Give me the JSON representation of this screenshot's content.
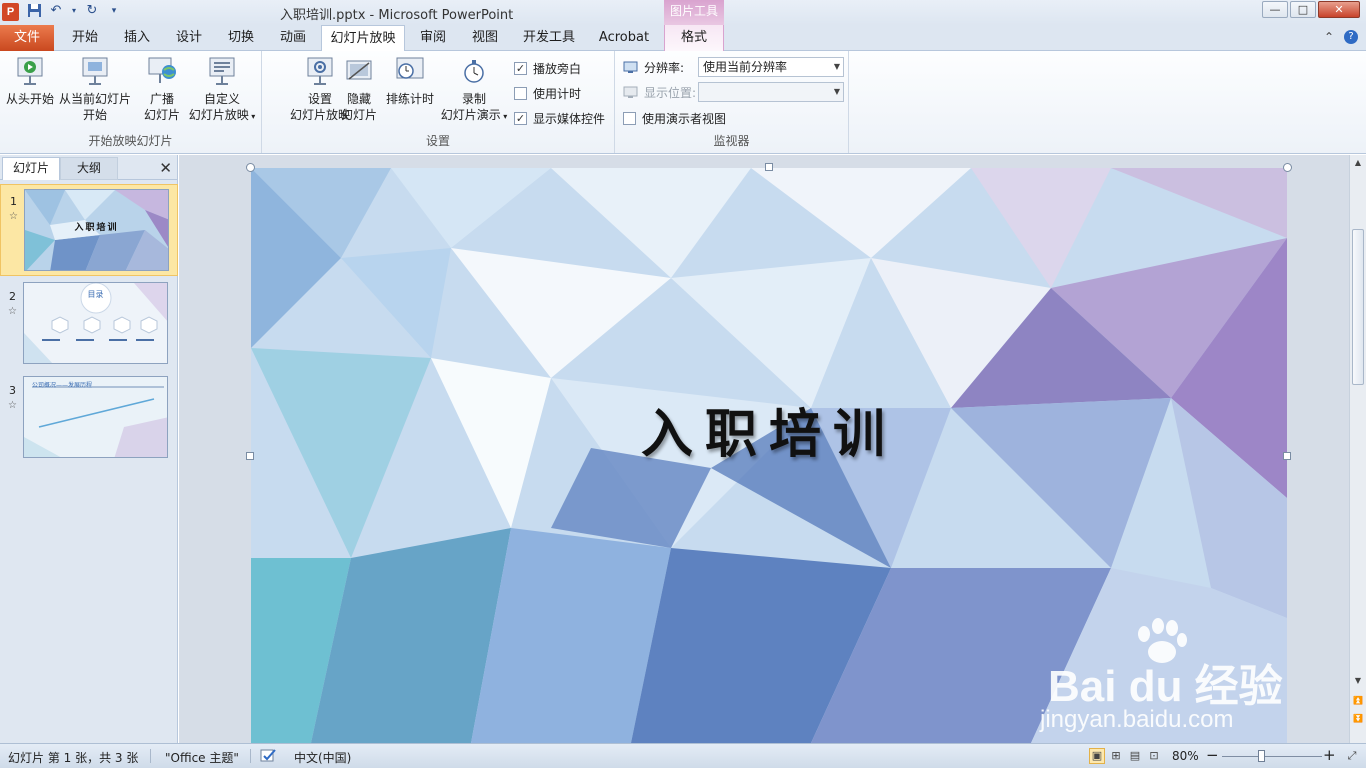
{
  "window": {
    "title": "入职培训.pptx  -  Microsoft PowerPoint",
    "app_icon_letter": "P",
    "context_tools_label": "图片工具",
    "controls": {
      "minimize": "—",
      "maximize": "□",
      "close": "✕"
    }
  },
  "quick_access": {
    "save_icon": "save-icon",
    "undo_icon": "undo-icon",
    "redo_icon": "redo-icon",
    "customize_icon": "dropdown-icon"
  },
  "tabs": [
    {
      "label": "文件",
      "kind": "file"
    },
    {
      "label": "开始"
    },
    {
      "label": "插入"
    },
    {
      "label": "设计"
    },
    {
      "label": "切换"
    },
    {
      "label": "动画"
    },
    {
      "label": "幻灯片放映",
      "active": true
    },
    {
      "label": "审阅"
    },
    {
      "label": "视图"
    },
    {
      "label": "开发工具"
    },
    {
      "label": "Acrobat"
    },
    {
      "label": "格式",
      "context": true
    }
  ],
  "ribbon": {
    "group_start": {
      "label": "开始放映幻灯片",
      "from_beginning": "从头开始",
      "from_current_line1": "从当前幻灯片",
      "from_current_line2": "开始",
      "broadcast_line1": "广播",
      "broadcast_line2": "幻灯片",
      "custom_line1": "自定义",
      "custom_line2": "幻灯片放映"
    },
    "group_setup": {
      "label": "设置",
      "setup_line1": "设置",
      "setup_line2": "幻灯片放映",
      "hide_line1": "隐藏",
      "hide_line2": "幻灯片",
      "rehearse": "排练计时",
      "record_line1": "录制",
      "record_line2": "幻灯片演示",
      "play_narration": "播放旁白",
      "play_narration_checked": true,
      "use_timings": "使用计时",
      "use_timings_checked": false,
      "show_media_controls": "显示媒体控件",
      "show_media_controls_checked": true
    },
    "group_monitors": {
      "label": "监视器",
      "resolution_label": "分辨率:",
      "resolution_value": "使用当前分辨率",
      "show_on_label": "显示位置:",
      "show_on_value": "",
      "presenter_view": "使用演示者视图",
      "presenter_view_checked": false
    }
  },
  "left_panel": {
    "tab_slides": "幻灯片",
    "tab_outline": "大纲",
    "close": "✕",
    "thumbnails": [
      {
        "number": "1",
        "title": "入职培训",
        "selected": true
      },
      {
        "number": "2",
        "title": "目录",
        "selected": false
      },
      {
        "number": "3",
        "title": "公司概况——发展历程",
        "selected": false
      }
    ]
  },
  "slide": {
    "title": "入职培训"
  },
  "watermark": {
    "logo": "Bai du 经验",
    "url": "jingyan.baidu.com"
  },
  "status_bar": {
    "slide_info": "幻灯片 第 1 张，共 3 张",
    "theme": "\"Office 主题\"",
    "language": "中文(中国)",
    "zoom": "80%",
    "zoom_out": "−",
    "zoom_in": "+"
  },
  "colors": {
    "file_tab": "#d24726",
    "context_tab": "#d9a3cf",
    "selection": "#fce7a4"
  }
}
